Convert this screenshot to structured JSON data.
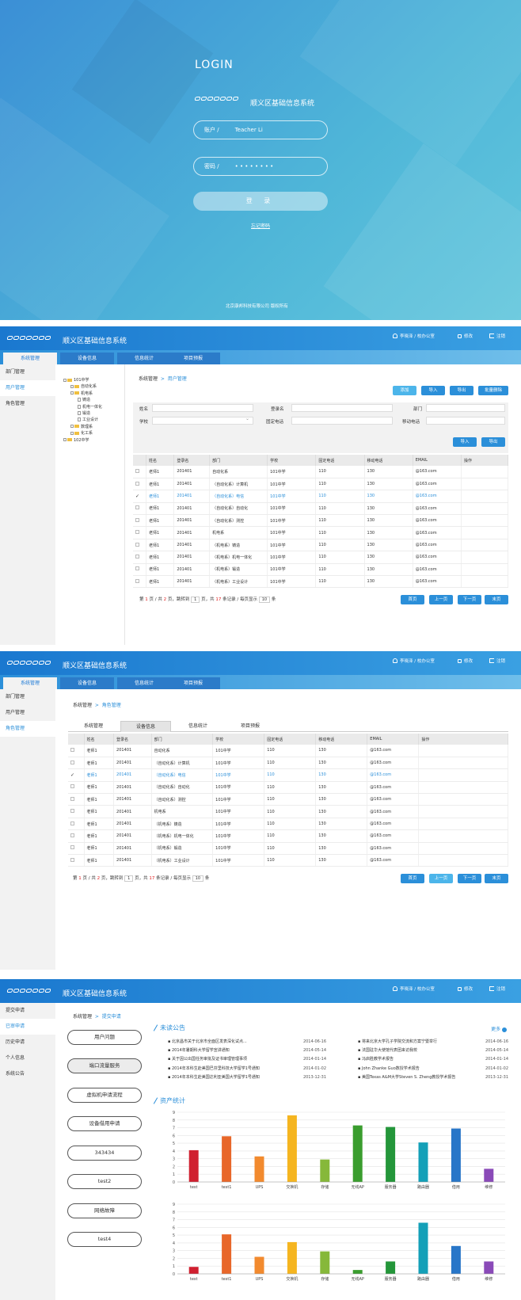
{
  "login": {
    "title": "LOGIN",
    "system_name": "顺义区基础信息系统",
    "account_label": "账户 /",
    "account_value": "Teacher Li",
    "password_label": "密码 /",
    "password_value": "• • • • • • • •",
    "login_button": "登 录",
    "forgot": "忘记密码",
    "copyright": "北京康邦科技有限公司  版权所有"
  },
  "header": {
    "system_name": "顺义区基础信息系统",
    "user": "李晓泽 / 校办公室",
    "password": "修改",
    "logout": "注销"
  },
  "tabs": [
    "系统管理",
    "设备信息",
    "信息统计",
    "项目预报"
  ],
  "screen2": {
    "sidebar": [
      "部门管理",
      "用户管理",
      "角色管理"
    ],
    "breadcrumb_root": "系统管理",
    "breadcrumb_current": "用户管理",
    "tree": [
      {
        "label": "101中学",
        "level": 0,
        "kind": "open"
      },
      {
        "label": "自动化系",
        "level": 1,
        "kind": "closed"
      },
      {
        "label": "机电系",
        "level": 1,
        "kind": "open"
      },
      {
        "label": "铸造",
        "level": 2,
        "kind": "leaf"
      },
      {
        "label": "机电一体化",
        "level": 2,
        "kind": "leaf"
      },
      {
        "label": "锻造",
        "level": 2,
        "kind": "leaf"
      },
      {
        "label": "工业设计",
        "level": 2,
        "kind": "leaf"
      },
      {
        "label": "数理系",
        "level": 1,
        "kind": "closed"
      },
      {
        "label": "化工系",
        "level": 1,
        "kind": "closed"
      },
      {
        "label": "102中学",
        "level": 0,
        "kind": "closed"
      }
    ],
    "actions": [
      "添加",
      "导入",
      "导出",
      "批量删除"
    ],
    "form": {
      "name": "姓名",
      "login": "登录名",
      "dept": "部门",
      "school": "学校",
      "phone": "固定电话",
      "mobile": "移动电话",
      "import": "导入",
      "export": "导出"
    },
    "columns": [
      "",
      "姓名",
      "登录名",
      "部门",
      "学校",
      "固定电话",
      "移动电话",
      "EMAIL",
      "操作"
    ],
    "pager": {
      "text1": "第",
      "page": "1",
      "text2": "页 / 共",
      "total": "2",
      "text3": "页，跳转到",
      "jump": "1",
      "text4": "页，共",
      "count": "17",
      "text5": "条记录 / 每页显示",
      "size": "10",
      "text6": "条"
    },
    "pager_buttons": [
      "首页",
      "上一页",
      "下一页",
      "末页"
    ]
  },
  "rows": [
    [
      "老师1",
      "201401",
      "自动化系",
      "101中学",
      "110",
      "130",
      "@163.com"
    ],
    [
      "老师1",
      "201401",
      "（自动化系）计算机",
      "101中学",
      "110",
      "130",
      "@163.com"
    ],
    [
      "老师1",
      "201401",
      "（自动化系）电信",
      "101中学",
      "110",
      "130",
      "@163.com"
    ],
    [
      "老师1",
      "201401",
      "（自动化系）自动化",
      "101中学",
      "110",
      "130",
      "@163.com"
    ],
    [
      "老师1",
      "201401",
      "（自动化系）测控",
      "101中学",
      "110",
      "130",
      "@163.com"
    ],
    [
      "老师1",
      "201401",
      "机电系",
      "101中学",
      "110",
      "130",
      "@163.com"
    ],
    [
      "老师1",
      "201401",
      "（机电系）铸造",
      "101中学",
      "110",
      "130",
      "@163.com"
    ],
    [
      "老师1",
      "201401",
      "（机电系）机电一体化",
      "101中学",
      "110",
      "130",
      "@163.com"
    ],
    [
      "老师1",
      "201401",
      "（机电系）锻造",
      "101中学",
      "110",
      "130",
      "@163.com"
    ],
    [
      "老师1",
      "201401",
      "（机电系）工业设计",
      "101中学",
      "110",
      "130",
      "@163.com"
    ]
  ],
  "screen3": {
    "sidebar": [
      "部门管理",
      "用户管理",
      "角色管理"
    ],
    "breadcrumb_root": "系统管理",
    "breadcrumb_current": "角色管理",
    "subtabs": [
      "系统管理",
      "设备信息",
      "信息统计",
      "项目预报"
    ]
  },
  "screen4": {
    "sidebar": [
      "提交申请",
      "已审申请",
      "历史申请",
      "个人信息",
      "系统公告"
    ],
    "breadcrumb_root": "系统管理",
    "breadcrumb_current": "提交申请",
    "pills": [
      "用户问题",
      "端口流量服务",
      "虚拟机申请流程",
      "设备借用申请",
      "343434",
      "test2",
      "网络故障",
      "test4"
    ],
    "notice_title": "未读公告",
    "more": "更多",
    "news_left": [
      [
        "北京昌市关于北京市全面区发表深化试点...",
        "2014-06-16"
      ],
      [
        "2014年暑期科大学留学宣讲通知",
        "2014-05-14"
      ],
      [
        "关于因公出国任务审批及证书审理管理事项",
        "2014-01-14"
      ],
      [
        "2014年本科生赴美国巴芬里科技大学留学1号通知",
        "2014-01-02"
      ],
      [
        "2014年本科生赴美国达利亚美国大学留学1号通知",
        "2013-12-31"
      ]
    ],
    "news_right": [
      [
        "将来北京大学孔子学院交流和方案宁暨举行",
        "2014-06-16"
      ],
      [
        "法国驻华大使馆代表团来访我校",
        "2014-05-14"
      ],
      [
        "冯启胜教学术报告",
        "2014-01-14"
      ],
      [
        "John Zhanke Guo数授学术报告",
        "2014-01-02"
      ],
      [
        "美国Texas A&M大学Steven S. Zheng教授学术报告",
        "2013-12-31"
      ]
    ],
    "stats_title": "资产统计"
  },
  "chart_data": [
    {
      "type": "bar",
      "categories": [
        "test",
        "test1",
        "UPS",
        "交换机",
        "存储",
        "无线AP",
        "服务器",
        "路由器",
        "借用",
        "维修"
      ],
      "values": [
        4.1,
        5.9,
        3.3,
        8.6,
        2.9,
        7.3,
        7.1,
        5.1,
        6.9,
        1.7
      ],
      "ylim": [
        0,
        9
      ],
      "colors": [
        "#d02030",
        "#e8672a",
        "#f28a2e",
        "#f5b520",
        "#86b83a",
        "#3a9d2e",
        "#24963a",
        "#14a0b8",
        "#2876c8",
        "#8a4ab8"
      ]
    },
    {
      "type": "bar",
      "categories": [
        "test",
        "test1",
        "UPS",
        "交换机",
        "存储",
        "无线AP",
        "服务器",
        "路由器",
        "借用",
        "维修"
      ],
      "values": [
        0.9,
        5.1,
        2.2,
        4.1,
        2.9,
        0.5,
        1.6,
        6.6,
        3.6,
        1.6
      ],
      "ylim": [
        0,
        9
      ],
      "colors": [
        "#d02030",
        "#e8672a",
        "#f28a2e",
        "#f5b520",
        "#86b83a",
        "#3a9d2e",
        "#24963a",
        "#14a0b8",
        "#2876c8",
        "#8a4ab8"
      ]
    }
  ]
}
